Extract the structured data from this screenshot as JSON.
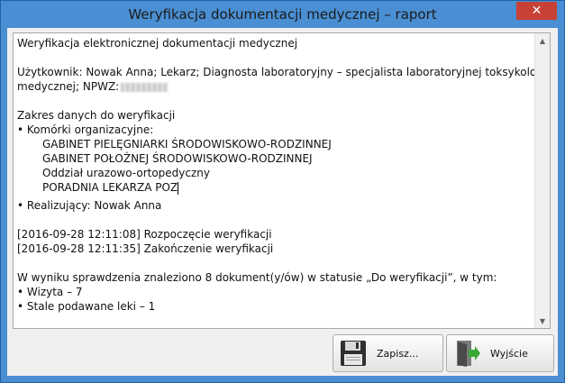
{
  "window": {
    "title": "Weryfikacja dokumentacji medycznej – raport"
  },
  "report": {
    "heading": "Weryfikacja elektronicznej dokumentacji medycznej",
    "user_line_1": "Użytkownik: Nowak Anna; Lekarz; Diagnosta laboratoryjny – specjalista laboratoryjnej toksykologii",
    "user_line_2": "medycznej; NPWZ:",
    "scope_title": "Zakres danych do weryfikacji",
    "units_label": "• Komórki organizacyjne:",
    "units": [
      "GABINET PIELĘGNIARKI ŚRODOWISKOWO-RODZINNEJ",
      "GABINET POŁOŻNEJ ŚRODOWISKOWO-RODZINNEJ",
      "Oddział urazowo-ortopedyczny",
      "PORADNIA LEKARZA POZ"
    ],
    "realizer": "• Realizujący: Nowak Anna",
    "log_start": "[2016-09-28 12:11:08] Rozpoczęcie weryfikacji",
    "log_end": "[2016-09-28 12:11:35] Zakończenie weryfikacji",
    "summary": "W wyniku sprawdzenia znaleziono 8 dokument(y/ów) w statusie „Do weryfikacji”, w tym:",
    "items": [
      "• Wizyta – 7",
      "• Stale podawane leki – 1"
    ]
  },
  "buttons": {
    "save_label": "Zapisz...",
    "exit_label": "Wyjście"
  },
  "icons": {
    "save": "floppy-disk-icon",
    "exit": "door-exit-icon",
    "close": "close-icon"
  },
  "colors": {
    "titlebar": "#4a8fd3",
    "close": "#c84137",
    "exit_arrow": "#3aa935"
  }
}
